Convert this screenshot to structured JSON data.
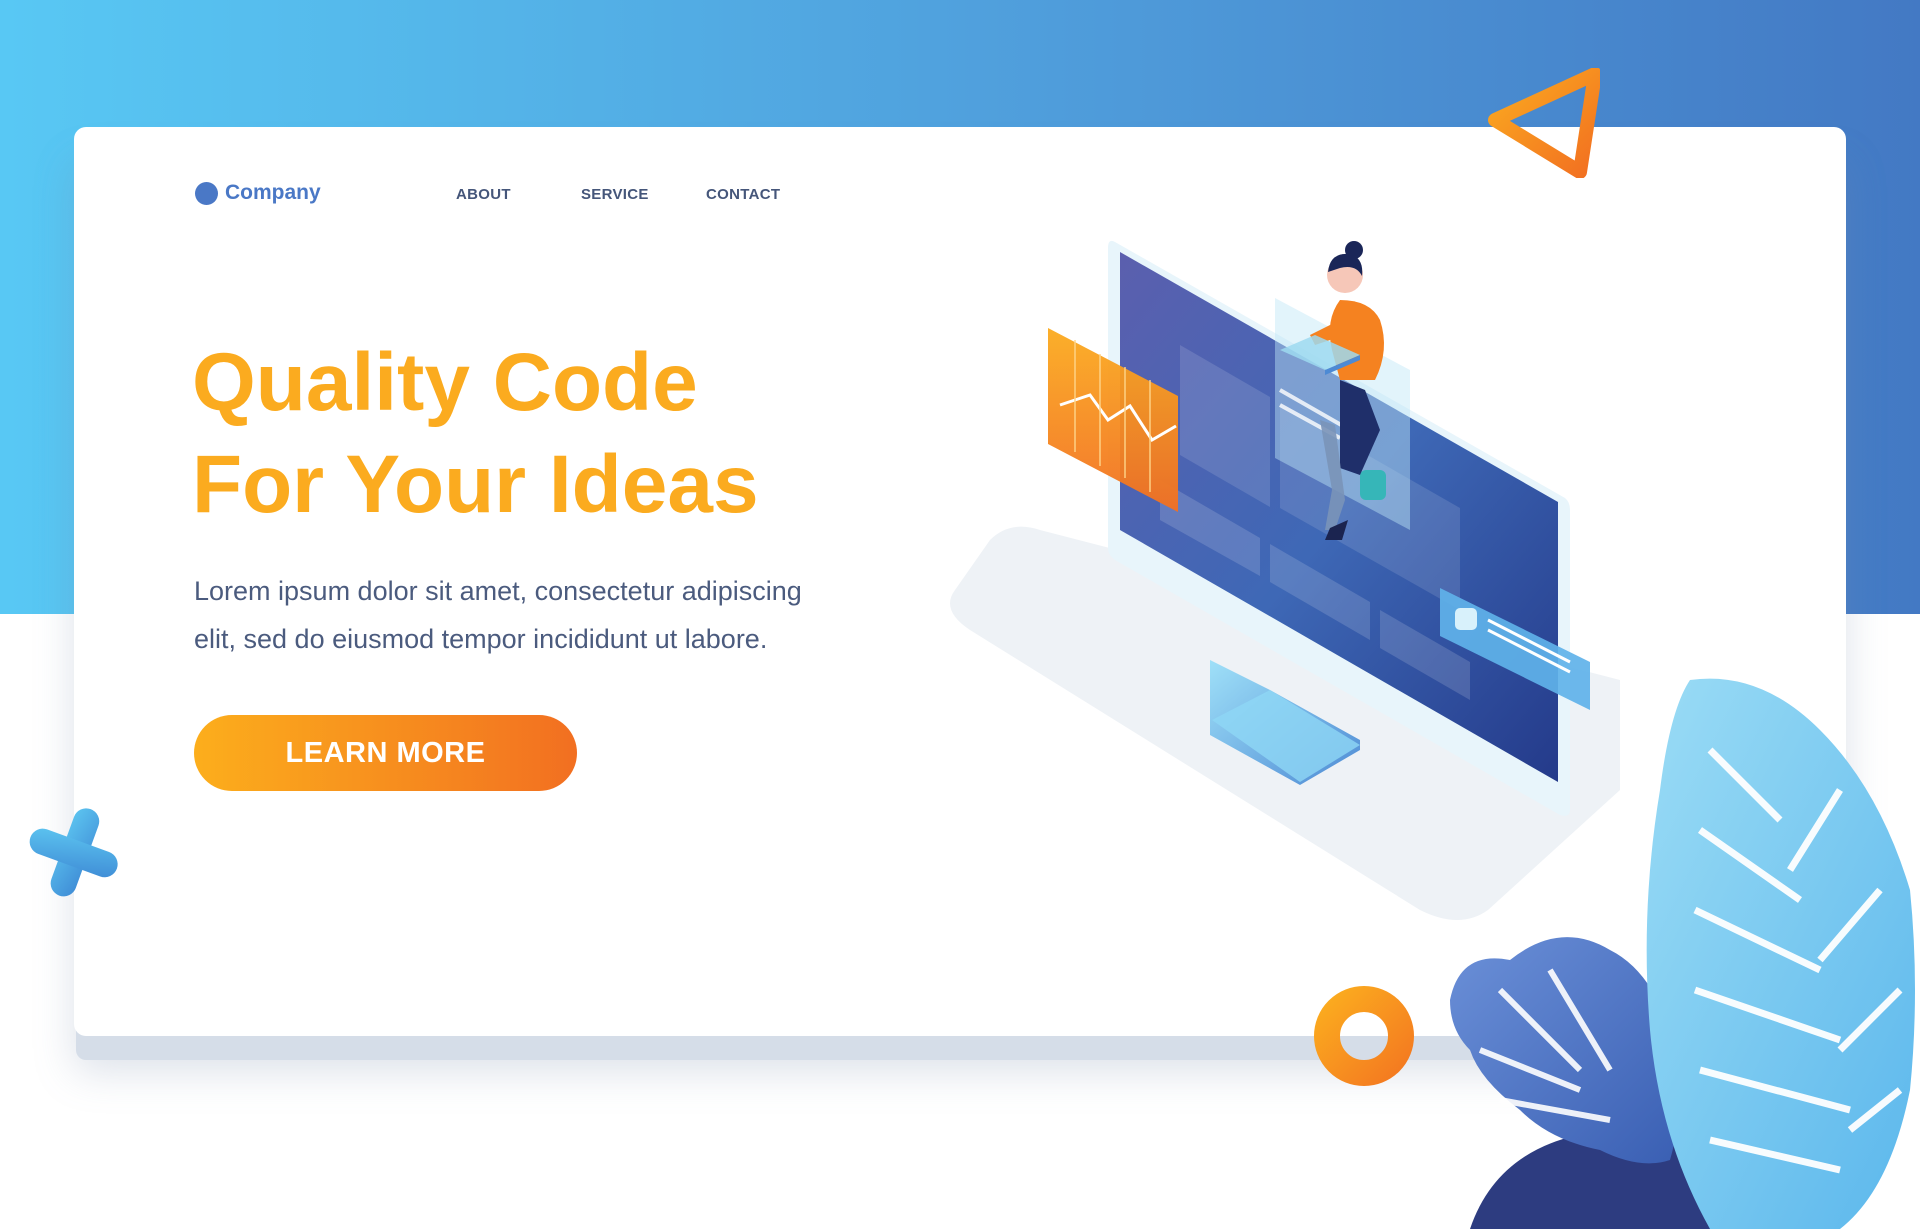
{
  "brand": {
    "name": "Company",
    "color": "#4a78c6"
  },
  "nav": {
    "items": [
      "ABOUT",
      "SERVICE",
      "CONTACT"
    ]
  },
  "hero": {
    "title_lines": [
      "Quality Code",
      "For Your Ideas"
    ],
    "subtitle_lines": [
      "Lorem ipsum dolor sit amet, consectetur adipiscing",
      "elit, sed do eiusmod tempor incididunt ut labore."
    ],
    "cta_label": "LEARN MORE"
  },
  "colors": {
    "accent_orange": "#fbab1f",
    "accent_orange_dark": "#f26f21",
    "background_blue_light": "#58c8f4",
    "background_blue_dark": "#4379c4",
    "text_body": "#4b5b7e"
  },
  "illustration": {
    "subject": "woman sitting on monitor with laptop",
    "icons": [
      "triangle-icon",
      "cross-icon",
      "ring-icon",
      "leaf-icon"
    ]
  }
}
